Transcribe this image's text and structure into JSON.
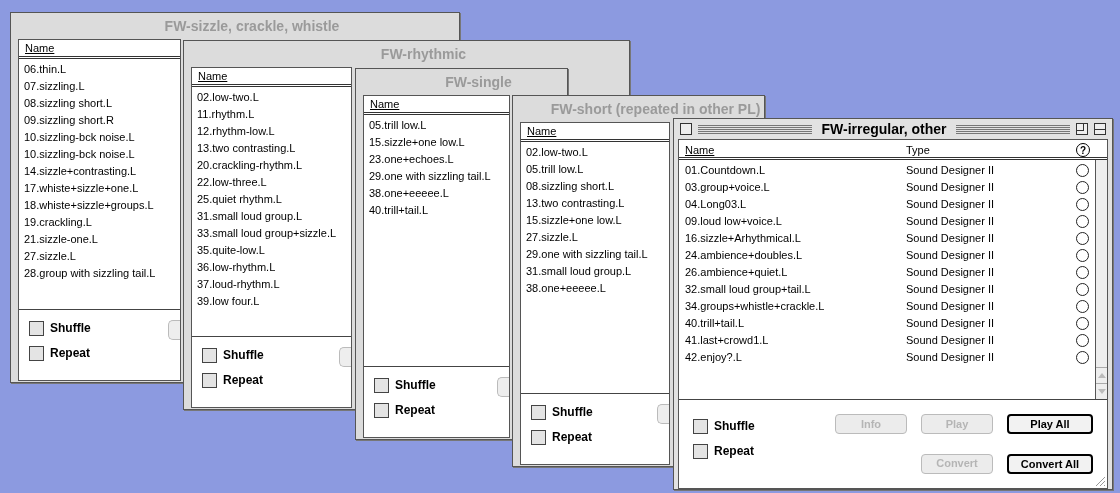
{
  "windows": [
    {
      "title": "FW-sizzle, crackle, whistle",
      "active": false,
      "columns": [
        "Name"
      ],
      "rows": [
        {
          "name": "06.thin.L"
        },
        {
          "name": "07.sizzling.L"
        },
        {
          "name": "08.sizzling short.L"
        },
        {
          "name": "09.sizzling short.R"
        },
        {
          "name": "10.sizzling-bck noise.L"
        },
        {
          "name": "10.sizzling-bck noise.L"
        },
        {
          "name": "14.sizzle+contrasting.L"
        },
        {
          "name": "17.whiste+sizzle+one.L"
        },
        {
          "name": "18.whiste+sizzle+groups.L"
        },
        {
          "name": "19.crackling.L"
        },
        {
          "name": "21.sizzle-one.L"
        },
        {
          "name": "27.sizzle.L"
        },
        {
          "name": "28.group with sizzling tail.L"
        }
      ],
      "shuffle": {
        "label": "Shuffle",
        "checked": false
      },
      "repeat": {
        "label": "Repeat",
        "checked": false
      }
    },
    {
      "title": "FW-rhythmic",
      "active": false,
      "columns": [
        "Name"
      ],
      "rows": [
        {
          "name": "02.low-two.L"
        },
        {
          "name": "11.rhythm.L"
        },
        {
          "name": "12.rhythm-low.L"
        },
        {
          "name": "13.two contrasting.L"
        },
        {
          "name": "20.crackling-rhythm.L"
        },
        {
          "name": "22.low-three.L"
        },
        {
          "name": "25.quiet rhythm.L"
        },
        {
          "name": "31.small loud group.L"
        },
        {
          "name": "33.small loud group+sizzle.L"
        },
        {
          "name": "35.quite-low.L"
        },
        {
          "name": "36.low-rhythm.L"
        },
        {
          "name": "37.loud-rhythm.L"
        },
        {
          "name": "39.low four.L"
        }
      ],
      "shuffle": {
        "label": "Shuffle",
        "checked": false
      },
      "repeat": {
        "label": "Repeat",
        "checked": false
      }
    },
    {
      "title": "FW-single",
      "active": false,
      "columns": [
        "Name"
      ],
      "rows": [
        {
          "name": "05.trill low.L"
        },
        {
          "name": "15.sizzle+one low.L"
        },
        {
          "name": "23.one+echoes.L"
        },
        {
          "name": "29.one with sizzling tail.L"
        },
        {
          "name": "38.one+eeeee.L"
        },
        {
          "name": "40.trill+tail.L"
        }
      ],
      "shuffle": {
        "label": "Shuffle",
        "checked": false
      },
      "repeat": {
        "label": "Repeat",
        "checked": false
      }
    },
    {
      "title": "FW-short (repeated in other PL)",
      "active": false,
      "columns": [
        "Name"
      ],
      "rows": [
        {
          "name": "02.low-two.L"
        },
        {
          "name": "05.trill low.L"
        },
        {
          "name": "08.sizzling short.L"
        },
        {
          "name": "13.two contrasting.L"
        },
        {
          "name": "15.sizzle+one low.L"
        },
        {
          "name": "27.sizzle.L"
        },
        {
          "name": "29.one with sizzling tail.L"
        },
        {
          "name": "31.small loud group.L"
        },
        {
          "name": "38.one+eeeee.L"
        }
      ],
      "shuffle": {
        "label": "Shuffle",
        "checked": false
      },
      "repeat": {
        "label": "Repeat",
        "checked": false
      }
    },
    {
      "title": "FW-irregular, other",
      "active": true,
      "columns": [
        "Name",
        "Type",
        "?"
      ],
      "rows": [
        {
          "name": "01.Countdown.L",
          "type": "Sound Designer II",
          "marked": false
        },
        {
          "name": "03.group+voice.L",
          "type": "Sound Designer II",
          "marked": false
        },
        {
          "name": "04.Long03.L",
          "type": "Sound Designer II",
          "marked": false
        },
        {
          "name": "09.loud low+voice.L",
          "type": "Sound Designer II",
          "marked": false
        },
        {
          "name": "16.sizzle+Arhythmical.L",
          "type": "Sound Designer II",
          "marked": false
        },
        {
          "name": "24.ambience+doubles.L",
          "type": "Sound Designer II",
          "marked": false
        },
        {
          "name": "26.ambience+quiet.L",
          "type": "Sound Designer II",
          "marked": false
        },
        {
          "name": "32.small loud group+tail.L",
          "type": "Sound Designer II",
          "marked": false
        },
        {
          "name": "34.groups+whistle+crackle.L",
          "type": "Sound Designer II",
          "marked": false
        },
        {
          "name": "40.trill+tail.L",
          "type": "Sound Designer II",
          "marked": false
        },
        {
          "name": "41.last+crowd1.L",
          "type": "Sound Designer II",
          "marked": false
        },
        {
          "name": "42.enjoy?.L",
          "type": "Sound Designer II",
          "marked": false
        }
      ],
      "shuffle": {
        "label": "Shuffle",
        "checked": false
      },
      "repeat": {
        "label": "Repeat",
        "checked": false
      },
      "buttons": [
        {
          "label": "Info",
          "disabled": true
        },
        {
          "label": "Play",
          "disabled": true
        },
        {
          "label": "Play All",
          "disabled": false
        },
        {
          "label": "Convert",
          "disabled": true
        },
        {
          "label": "Convert All",
          "disabled": false
        }
      ]
    }
  ]
}
